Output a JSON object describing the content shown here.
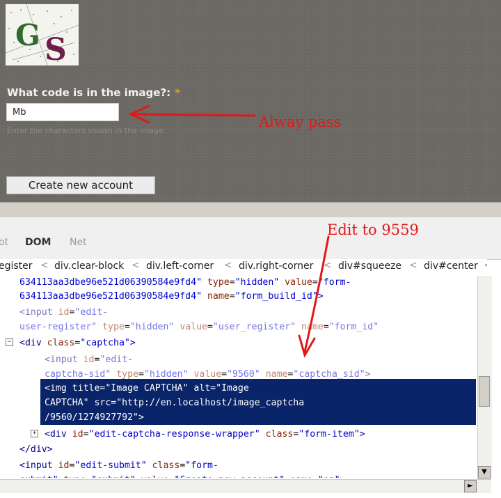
{
  "form": {
    "question_label": "What code is in the image?:",
    "required_mark": "*",
    "code_value": "Mb",
    "hint": "Enter the characters shown in the image.",
    "submit_label": "Create new account"
  },
  "annotations": {
    "pass_note": "Alway pass",
    "edit_note": "Edit to 9559",
    "color": "#e01818"
  },
  "firebug": {
    "tabs": [
      "ot",
      "DOM",
      "Net"
    ],
    "breadcrumbs": [
      "egister",
      "div.clear-block",
      "div.left-corner",
      "div.right-corner",
      "div#squeeze",
      "div#center"
    ],
    "breadcrumb_separator": "<",
    "scroll_icons": {
      "down": "down-arrow-icon",
      "right": "right-arrow-icon"
    },
    "selection_color": "#0a246a"
  }
}
